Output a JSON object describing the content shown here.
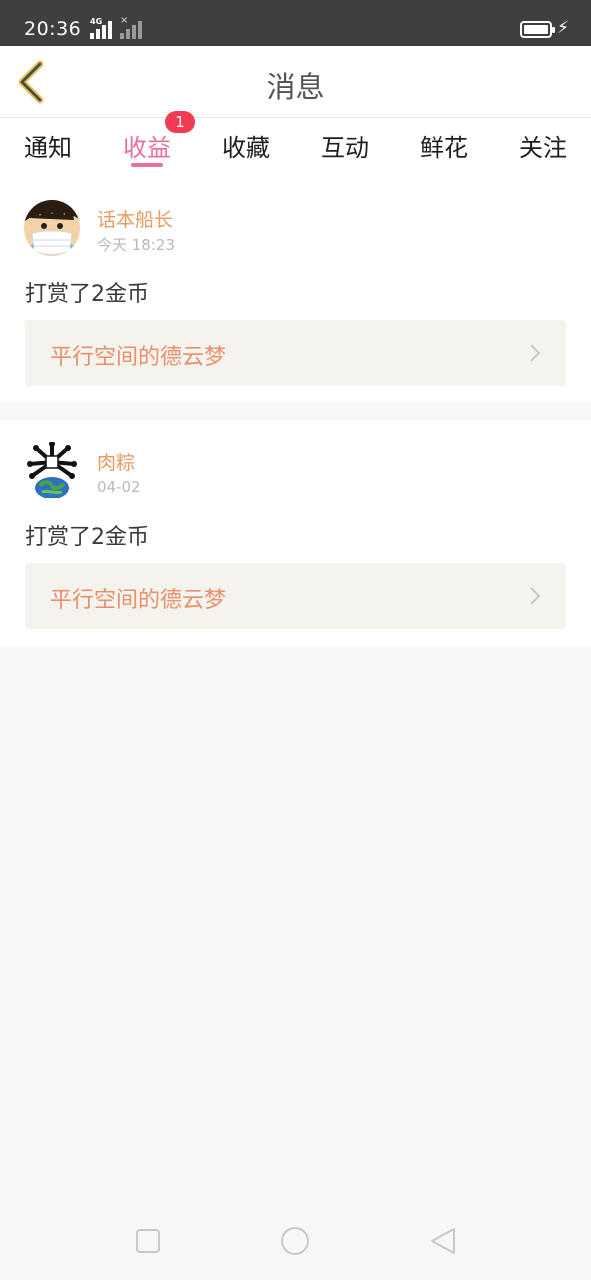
{
  "status_bar": {
    "time": "20:36",
    "network_label": "4G",
    "secondary_signal_mark": "×",
    "charging_icon": "bolt-icon"
  },
  "header": {
    "title": "消息",
    "back_icon": "chevron-left-icon"
  },
  "tabs": [
    {
      "label": "通知",
      "active": false
    },
    {
      "label": "收益",
      "active": true,
      "badge": "1"
    },
    {
      "label": "收藏",
      "active": false
    },
    {
      "label": "互动",
      "active": false
    },
    {
      "label": "鲜花",
      "active": false
    },
    {
      "label": "关注",
      "active": false
    }
  ],
  "messages": [
    {
      "username": "话本船长",
      "time": "今天 18:23",
      "action": "打赏了2金币",
      "book": "平行空间的德云梦"
    },
    {
      "username": "肉粽",
      "time": "04-02",
      "action": "打赏了2金币",
      "book": "平行空间的德云梦"
    }
  ],
  "colors": {
    "accent": "#e870a0",
    "badge": "#f23b53",
    "username": "#e89a60",
    "book_title": "#e8906a",
    "status_bar": "#3f3f3f"
  },
  "system_nav": [
    "recents-square-icon",
    "home-circle-icon",
    "back-triangle-icon"
  ]
}
